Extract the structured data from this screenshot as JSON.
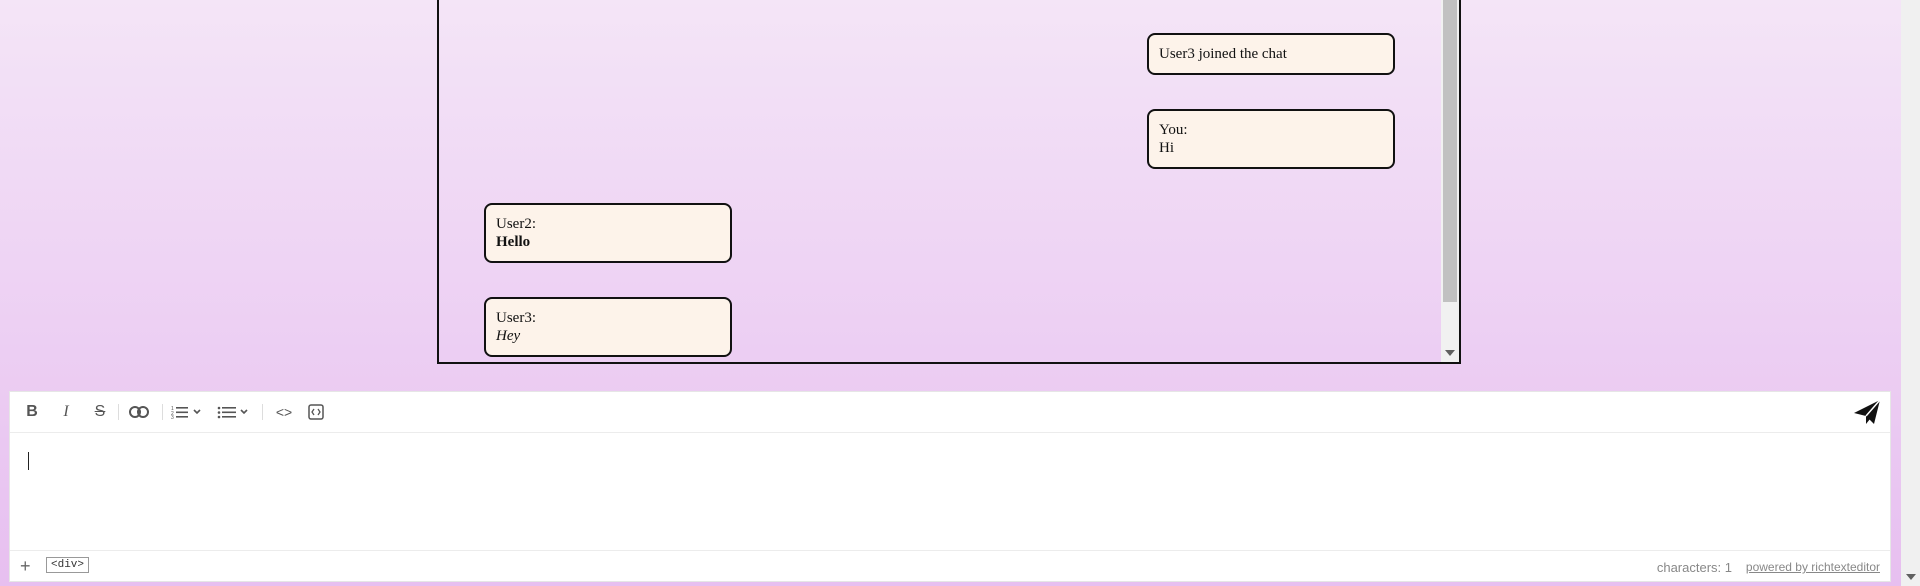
{
  "chat": {
    "messages": [
      {
        "author": "User3 joined the chat",
        "text": ""
      },
      {
        "author": "You:",
        "text": "Hi"
      },
      {
        "author": "User2:",
        "text": "Hello"
      },
      {
        "author": "User3:",
        "text": "Hey"
      }
    ]
  },
  "editor": {
    "toolbar": {
      "bold": "B",
      "italic": "I",
      "strike": "S",
      "code": "<>"
    },
    "status": {
      "tag": "<div>",
      "characters": "characters: 1",
      "powered": "powered by richtexteditor"
    }
  }
}
